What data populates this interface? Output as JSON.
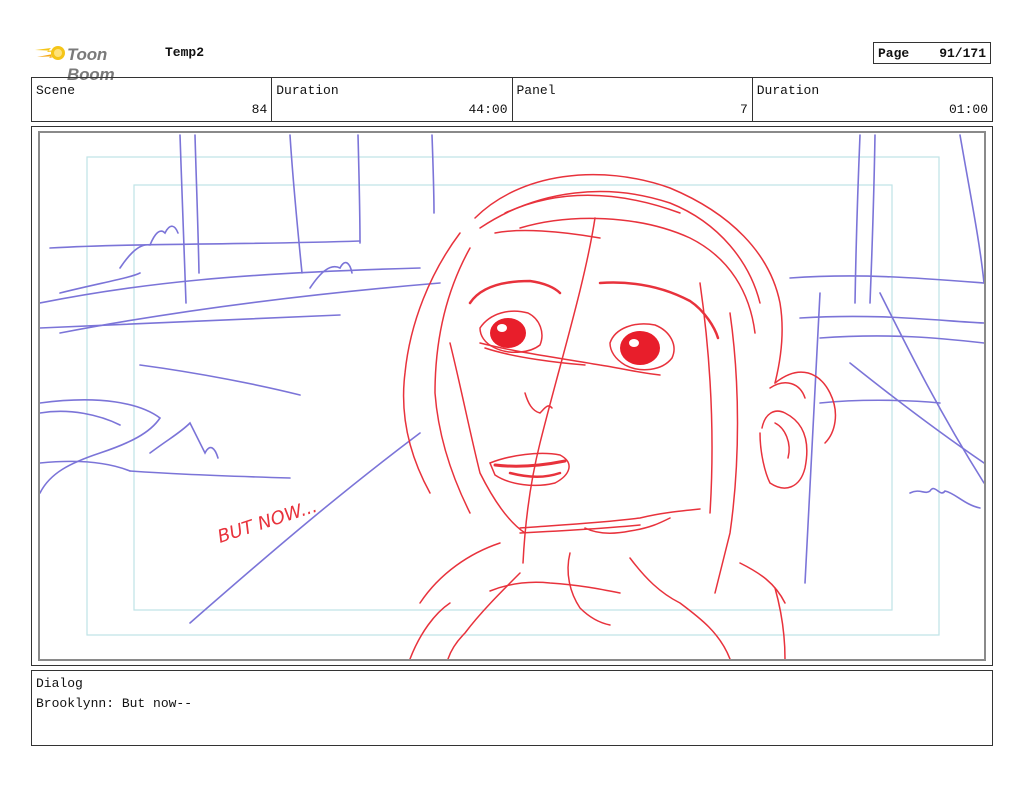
{
  "header": {
    "logo_text": "Toon Boom",
    "project": "Temp2",
    "page_label": "Page",
    "page_value": "91/171"
  },
  "info": {
    "scene_label": "Scene",
    "scene_value": "84",
    "duration_label": "Duration",
    "duration_value": "44:00",
    "panel_label": "Panel",
    "panel_value": "7",
    "panel_duration_label": "Duration",
    "panel_duration_value": "01:00"
  },
  "panel": {
    "handwritten_text": "BUT NOW...",
    "sketch_colors": {
      "character": "#e8323c",
      "background": "#7b74d8",
      "safe_frame": "#bfe3e6"
    }
  },
  "dialog": {
    "label": "Dialog",
    "text": "Brooklynn: But now--"
  }
}
